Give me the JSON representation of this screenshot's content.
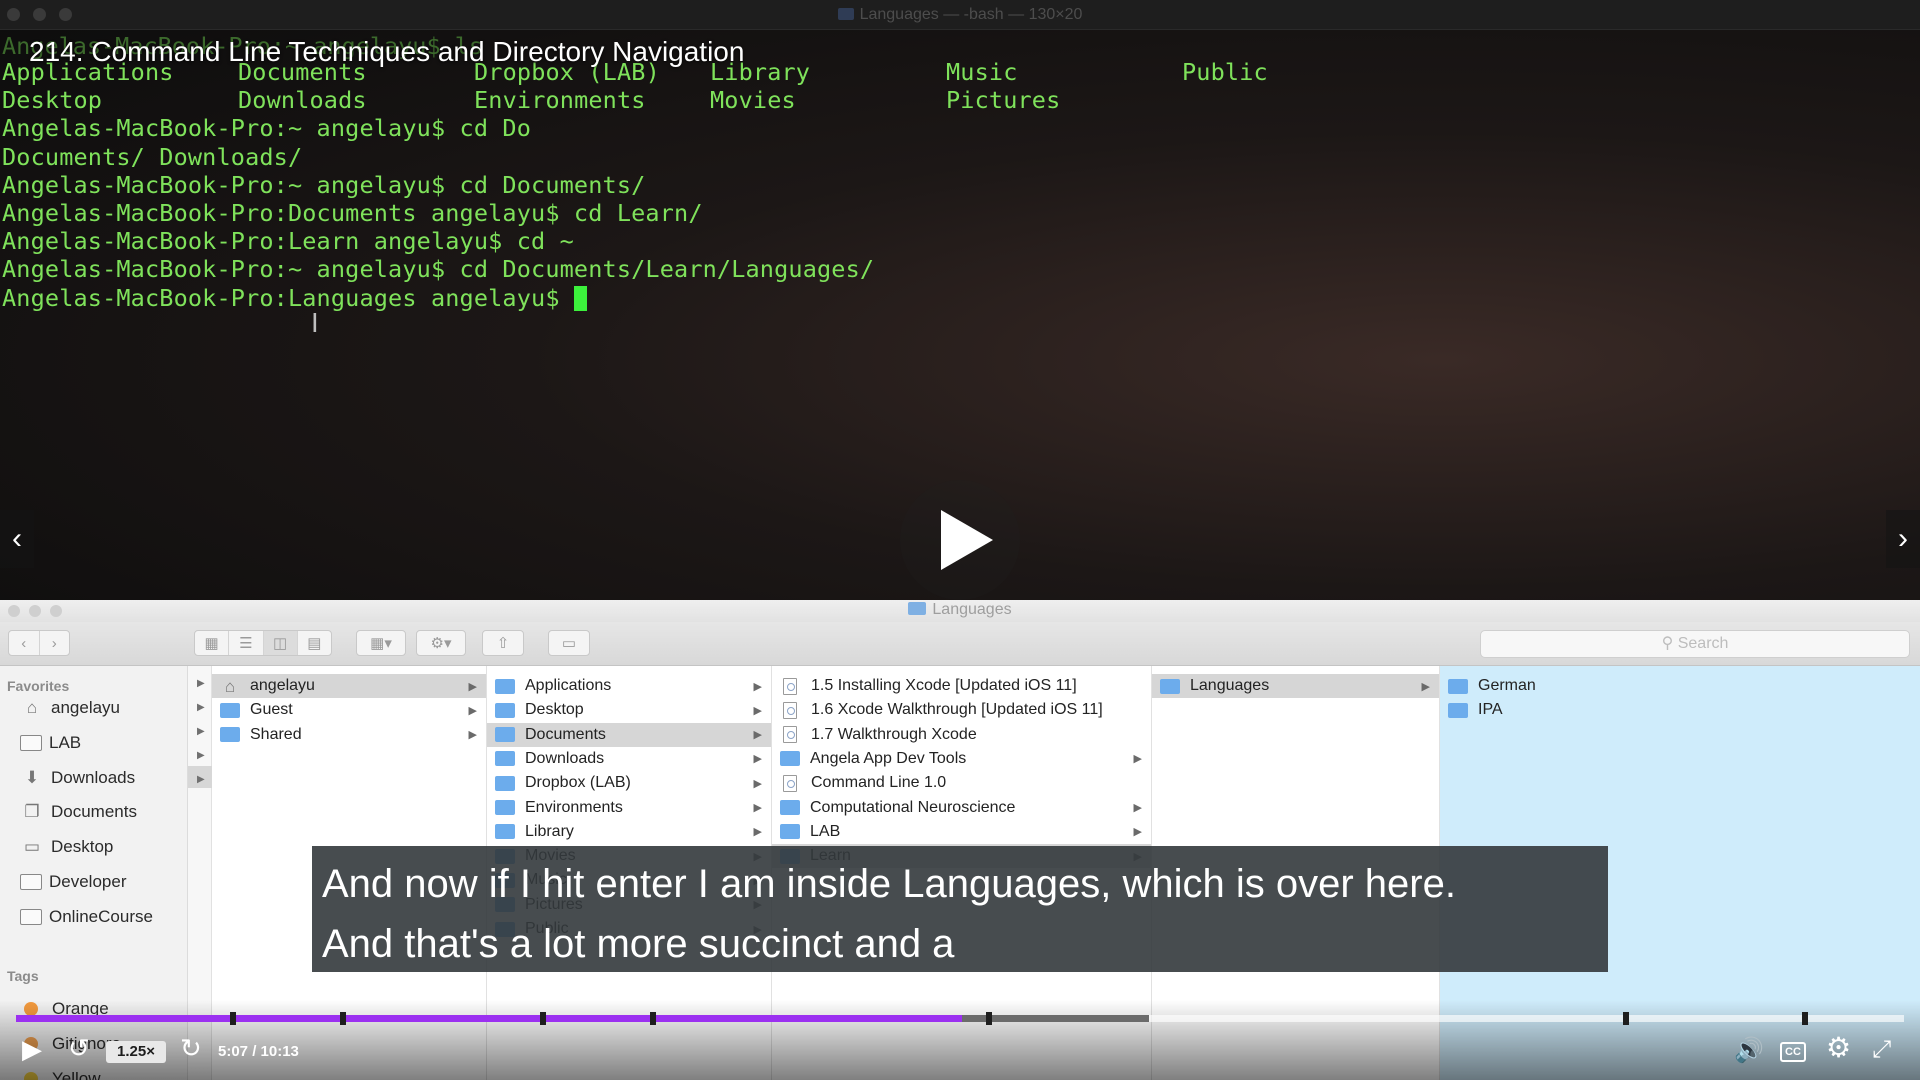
{
  "video": {
    "title": "214. Command Line Techniques and Directory Navigation",
    "caption_lines": [
      "And now if I hit enter I am inside Languages, which is over here.",
      "And that's a lot more succinct and a"
    ],
    "time": "5:07 / 10:13",
    "speed": "1.25×",
    "progress_played": 0.501,
    "progress_buffered": 0.6,
    "chapter_marks": [
      0.1133,
      0.1718,
      0.2775,
      0.336,
      0.5138,
      0.8512,
      0.946
    ]
  },
  "terminal": {
    "window_title": "Languages — -bash — 130×20",
    "ghost_line": "Angelas-MacBook-Pro:~ angelayu$ ls",
    "ls_rows": [
      [
        "Applications",
        "Documents",
        "Dropbox (LAB)",
        "Library",
        "Music",
        "Public"
      ],
      [
        "Desktop",
        "Downloads",
        "Environments",
        "Movies",
        "Pictures",
        ""
      ]
    ],
    "lines": [
      "Angelas-MacBook-Pro:~ angelayu$ cd Do",
      "Documents/ Downloads/",
      "Angelas-MacBook-Pro:~ angelayu$ cd Documents/",
      "Angelas-MacBook-Pro:Documents angelayu$ cd Learn/",
      "Angelas-MacBook-Pro:Learn angelayu$ cd ~",
      "Angelas-MacBook-Pro:~ angelayu$ cd Documents/Learn/Languages/"
    ],
    "prompt": "Angelas-MacBook-Pro:Languages angelayu$ "
  },
  "finder": {
    "window_title": "Languages",
    "search_placeholder": "Search",
    "sidebar": {
      "favorites_label": "Favorites",
      "favorites": [
        {
          "label": "angelayu",
          "icon": "home-icon"
        },
        {
          "label": "LAB",
          "icon": "folder-icon"
        },
        {
          "label": "Downloads",
          "icon": "downloads-icon"
        },
        {
          "label": "Documents",
          "icon": "documents-icon"
        },
        {
          "label": "Desktop",
          "icon": "desktop-icon"
        },
        {
          "label": "Developer",
          "icon": "folder-icon"
        },
        {
          "label": "OnlineCourse",
          "icon": "folder-icon"
        }
      ],
      "tags_label": "Tags",
      "tags": [
        {
          "label": "Orange",
          "color": "#f39a3e"
        },
        {
          "label": "Gitignore",
          "color": "#f0a050"
        },
        {
          "label": "Yellow",
          "color": "#f4d03f"
        }
      ]
    },
    "col1": [
      "angelayu",
      "Guest",
      "Shared"
    ],
    "col2": [
      "Applications",
      "Desktop",
      "Documents",
      "Downloads",
      "Dropbox (LAB)",
      "Environments",
      "Library",
      "Movies",
      "Music",
      "Pictures",
      "Public"
    ],
    "col3": [
      "1.5 Installing Xcode [Updated iOS 11]",
      "1.6 Xcode Walkthrough [Updated iOS 11]",
      "1.7 Walkthrough Xcode",
      "Angela App Dev Tools",
      "Command Line 1.0",
      "Computational Neuroscience",
      "LAB",
      "Learn"
    ],
    "col4": [
      "Languages"
    ],
    "col5": [
      "German",
      "IPA"
    ]
  }
}
